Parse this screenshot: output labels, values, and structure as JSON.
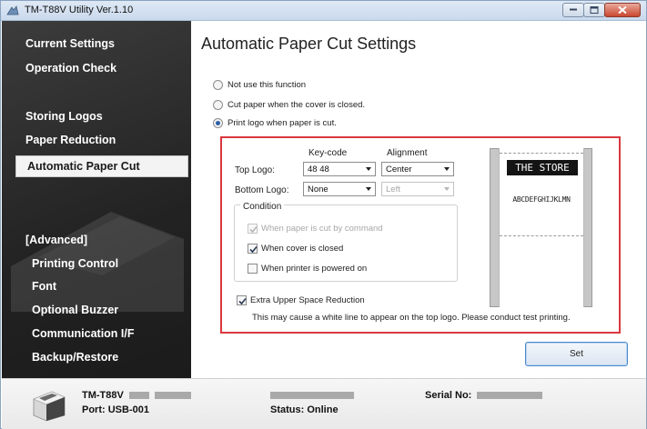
{
  "window": {
    "title": "TM-T88V Utility Ver.1.10"
  },
  "sidebar": {
    "items": [
      {
        "label": "Current Settings"
      },
      {
        "label": "Operation Check"
      },
      {
        "label": "Storing Logos"
      },
      {
        "label": "Paper Reduction"
      },
      {
        "label": "Automatic Paper Cut"
      }
    ],
    "advanced_label": "[Advanced]",
    "advanced_items": [
      {
        "label": "Printing Control"
      },
      {
        "label": "Font"
      },
      {
        "label": "Optional Buzzer"
      },
      {
        "label": "Communication I/F"
      },
      {
        "label": "Backup/Restore"
      }
    ]
  },
  "main": {
    "title": "Automatic Paper Cut Settings",
    "options": [
      {
        "label": "Not use this function",
        "selected": false
      },
      {
        "label": "Cut paper when the cover is closed.",
        "selected": false
      },
      {
        "label": "Print logo when paper is cut.",
        "selected": true
      }
    ],
    "keycode_header": "Key-code",
    "alignment_header": "Alignment",
    "top_logo": {
      "label": "Top Logo:",
      "keycode": "48  48",
      "alignment": "Center"
    },
    "bottom_logo": {
      "label": "Bottom Logo:",
      "keycode": "None",
      "alignment": "Left"
    },
    "condition": {
      "legend": "Condition",
      "items": [
        {
          "label": "When paper is cut by command",
          "checked": true,
          "enabled": false
        },
        {
          "label": "When cover is closed",
          "checked": true,
          "enabled": true
        },
        {
          "label": "When printer is powered on",
          "checked": false,
          "enabled": true
        }
      ]
    },
    "extra_space": {
      "label": "Extra Upper Space Reduction",
      "checked": true
    },
    "note": "This may cause a white line to appear on the top logo. Please conduct test printing.",
    "preview": {
      "logo_text": "THE STORE",
      "sample_text": "ABCDEFGHIJKLMN"
    },
    "set_button": "Set"
  },
  "footer": {
    "model": "TM-T88V",
    "port": "Port: USB-001",
    "status": "Status: Online",
    "serial_label": "Serial No:"
  },
  "colors": {
    "highlight_border": "#d9383e",
    "sidebar_bg": "#222222",
    "accent": "#4f89c9"
  }
}
